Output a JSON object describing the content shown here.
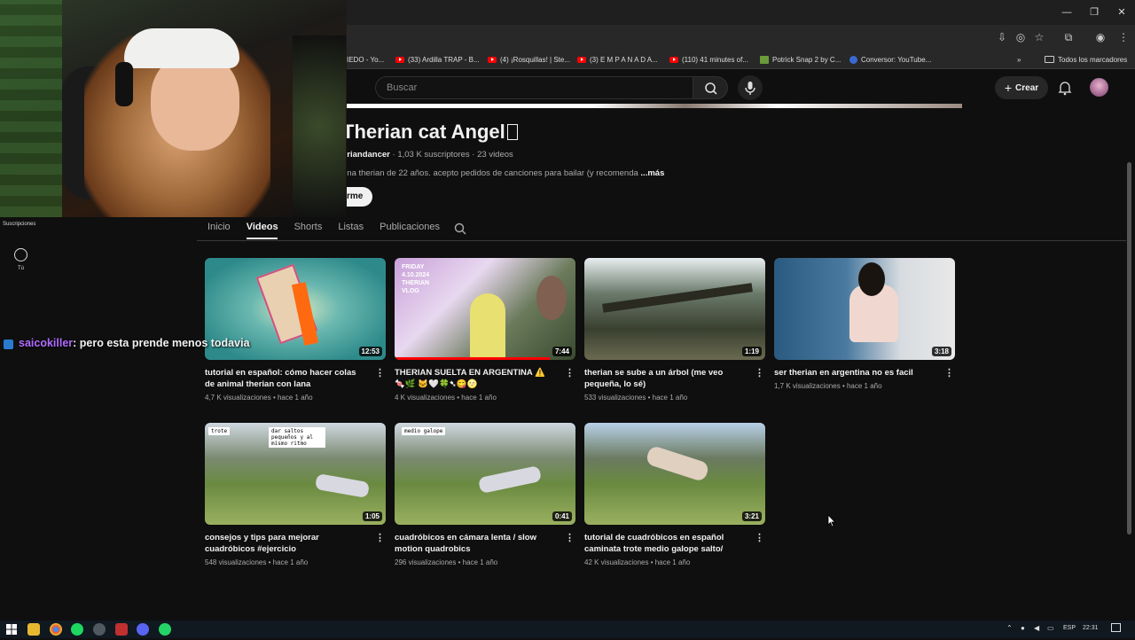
{
  "browser": {
    "window_controls": [
      "—",
      "❐",
      "✕"
    ],
    "bookmarks": [
      {
        "label": "IEDO - Yo...",
        "icon": "youtube-icon"
      },
      {
        "label": "(33) Ardilla TRAP - B...",
        "icon": "youtube-icon"
      },
      {
        "label": "(4) ¡Rosquillas! | Ste...",
        "icon": "youtube-icon"
      },
      {
        "label": "(3) E M P A N A D A...",
        "icon": "youtube-icon"
      },
      {
        "label": "(110) 41 minutes of...",
        "icon": "youtube-icon"
      },
      {
        "label": "Potrick Snap 2 by C...",
        "icon": "image-icon"
      },
      {
        "label": "Conversor: YouTube...",
        "icon": "converter-icon"
      }
    ],
    "bookmarks_overflow": "»",
    "all_bookmarks": "Todos los marcadores"
  },
  "masthead": {
    "search_placeholder": "Buscar",
    "create_label": "Crear"
  },
  "channel": {
    "name": "Therian cat Angel",
    "name_glyph": "⃞",
    "handle": "eriandancer",
    "subscribers": "1,03 K suscriptores",
    "videos_count": "23 videos",
    "description": "una therian de 22 años. acepto pedidos de canciones para bailar (y recomenda",
    "more": "...más",
    "subscribe_label": "rme"
  },
  "tabs": [
    {
      "label": "Inicio",
      "active": false
    },
    {
      "label": "Videos",
      "active": true
    },
    {
      "label": "Shorts",
      "active": false
    },
    {
      "label": "Listas",
      "active": false
    },
    {
      "label": "Publicaciones",
      "active": false
    }
  ],
  "guide": {
    "subscriptions": "Suscripciones",
    "you": "Tú"
  },
  "videos": [
    {
      "title": "tutorial en español: cómo hacer colas de animal therian con lana #theriantropy...",
      "views": "4,7 K visualizaciones",
      "age": "hace 1 año",
      "duration": "12:53",
      "progress": 0
    },
    {
      "title": "THERIAN SUELTA EN ARGENTINA ⚠️🍬🌿 🐱🤍🍀➷😋🌝",
      "views": "4 K visualizaciones",
      "age": "hace 1 año",
      "duration": "7:44",
      "progress": 0.86,
      "overlay": "FRIDAY 4.10.2024 THERIAN VLOG"
    },
    {
      "title": "therian se sube a un árbol (me veo pequeña, lo sé)",
      "views": "533 visualizaciones",
      "age": "hace 1 año",
      "duration": "1:19",
      "progress": 0
    },
    {
      "title": "ser therian en argentina no es facil",
      "views": "1,7 K visualizaciones",
      "age": "hace 1 año",
      "duration": "3:18",
      "progress": 0
    },
    {
      "title": "consejos y tips para mejorar cuadróbicos #ejercicio",
      "views": "548 visualizaciones",
      "age": "hace 1 año",
      "duration": "1:05",
      "progress": 0,
      "overlay": "trote",
      "overlay2": "dar saltos pequeños y al mismo ritmo"
    },
    {
      "title": "cuadróbicos en cámara lenta / slow motion quadrobics",
      "views": "296 visualizaciones",
      "age": "hace 1 año",
      "duration": "0:41",
      "progress": 0,
      "overlay": "medio galope"
    },
    {
      "title": "tutorial de cuadróbicos en español caminata trote medio galope salto/ cómo caminar en...",
      "views": "42 K visualizaciones",
      "age": "hace 1 año",
      "duration": "3:21",
      "progress": 0
    }
  ],
  "chat": {
    "user": "saicokiller",
    "message": ": pero esta prende menos todavia"
  },
  "taskbar": {
    "lang": "ESP",
    "clock": "22:31"
  },
  "colors": {
    "accent": "#ff0000",
    "chat_user": "#b06bff",
    "background": "#0f0f0f"
  }
}
